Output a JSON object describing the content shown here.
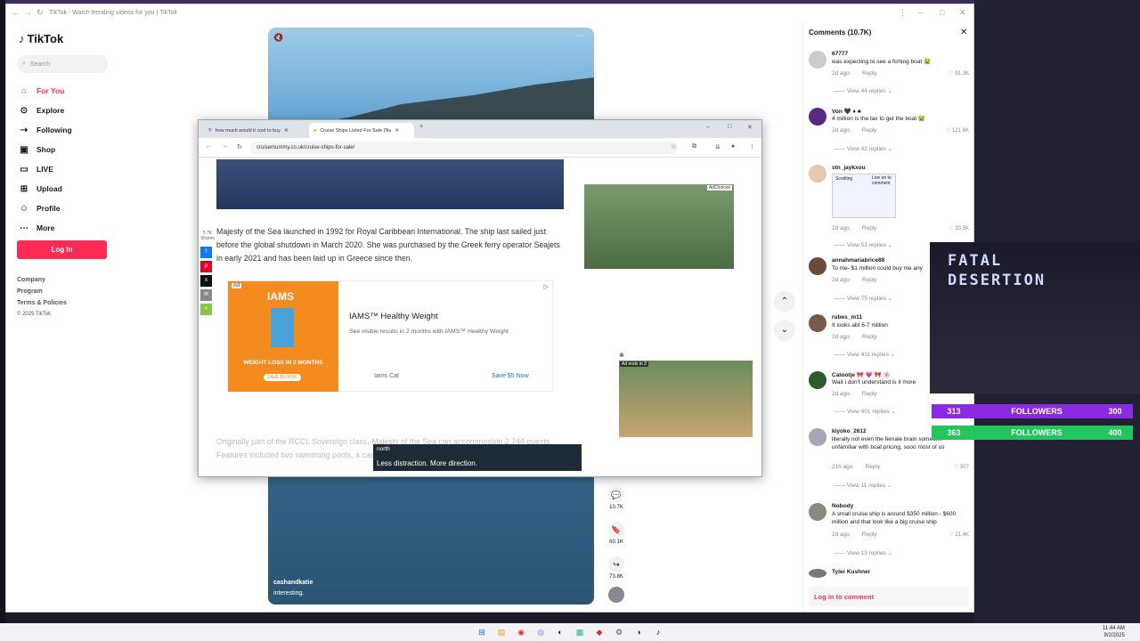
{
  "tiktok": {
    "window_title": "TikTok - Watch trending videos for you | TikTok",
    "logo": "TikTok",
    "search_placeholder": "Search",
    "nav": [
      "For You",
      "Explore",
      "Following",
      "Shop",
      "LIVE",
      "Upload",
      "Profile",
      "More"
    ],
    "login": "Log In",
    "footer": [
      "Company",
      "Program",
      "Terms & Policies",
      "© 2025 TikTok"
    ],
    "video": {
      "author": "cashandkatie",
      "caption": "interesting."
    },
    "actions": {
      "comments": "10.7K",
      "saves": "60.1K",
      "shares": "73.8K"
    }
  },
  "comments": {
    "header": "Comments (10.7K)",
    "items": [
      {
        "user": "67777",
        "text": "was expecting to see a fishing boat 😭",
        "meta": "2d ago",
        "reply": "Reply",
        "likes": "91.3K",
        "replies": "View 44 replies"
      },
      {
        "user": "Von 🖤 ♦ ♣",
        "text": "4 million is the tax to get the boat 😭",
        "meta": "2d ago",
        "reply": "Reply",
        "likes": "121.6K",
        "replies": "View 42 replies"
      },
      {
        "user": "stn_jaykxou",
        "text": "",
        "meta": "2d ago",
        "reply": "Reply",
        "likes": "33.5K",
        "replies": "View 53 replies"
      },
      {
        "user": "annahmariabrice88",
        "text": "To me- $1 million could buy me any",
        "meta": "2d ago",
        "reply": "Reply",
        "likes": "",
        "replies": "View 75 replies"
      },
      {
        "user": "rubes_m11",
        "text": "It looks abt 6-7 million",
        "meta": "2d ago",
        "reply": "Reply",
        "likes": "",
        "replies": "View 411 replies"
      },
      {
        "user": "Catootje 🎀 💗 🎀 🌸",
        "text": "Wait i don't understand is it more",
        "meta": "2d ago",
        "reply": "Reply",
        "likes": "",
        "replies": "View 401 replies"
      },
      {
        "user": "kiyoko_2612",
        "text": "literally not even the female brain someone unfamiliar with boat pricing, sooo most of us",
        "meta": "21h ago",
        "reply": "Reply",
        "likes": "307",
        "replies": "View 11 replies"
      },
      {
        "user": "Nobody",
        "text": "A small cruise ship is around $350 million - $600 million and that look like a big cruise ship",
        "meta": "2d ago",
        "reply": "Reply",
        "likes": "21.4K",
        "replies": "View 13 replies"
      },
      {
        "user": "Tyler Kushner",
        "text": "",
        "meta": "",
        "reply": "",
        "likes": "",
        "replies": ""
      }
    ],
    "login": "Log in to comment",
    "meme": {
      "top": "Scrolling",
      "side": "Live on to comment"
    }
  },
  "chrome": {
    "tabs": [
      "how much would it cost to buy",
      "Cruise Ships Listed For Sale (Nu"
    ],
    "url": "cruisemummy.co.uk/cruise-ships-for-sale/",
    "article": "Majesty of the Sea launched in 1992 for Royal Caribbean International. The ship last sailed just before the global shutdown in March 2020. She was purchased by the Greek ferry operator Seajets in early 2021 and has been laid up in Greece since then.",
    "share_count": "5.7K",
    "share_label": "Shares",
    "ad": {
      "label": "Ad",
      "headline": "IAMS™ Healthy Weight",
      "sub": "See visible results in 2 months with IAMS™ Healthy Weight",
      "brand": "Iams Cat",
      "cta": "Save $5 Now",
      "img_brand": "IAMS",
      "img_text": "WEIGHT LOSS IN 2 MONTHS",
      "img_cta": "SAVE $5 NOW"
    },
    "side_ad_label": "AdChoices",
    "video_ad_label": "Ad ends in 3",
    "faded_text": "Originally part of the RCCL Sovereign class, Majesty of the Sea can accommodate 2,744 guests. Features included two swimming pools, a casino, a basketball court, a rock-climbing wall",
    "banner": {
      "brand": "north",
      "tagline": "Less distraction. More direction."
    }
  },
  "overlay": {
    "title": "FATAL DESERTION",
    "bars": [
      {
        "a": "313",
        "b": "FOLLOWERS",
        "c": "300",
        "color": "#8a2be2"
      },
      {
        "a": "363",
        "b": "FOLLOWERS",
        "c": "400",
        "color": "#22c55e"
      }
    ]
  },
  "clock": {
    "time": "11:44 AM",
    "date": "9/2/2025"
  }
}
